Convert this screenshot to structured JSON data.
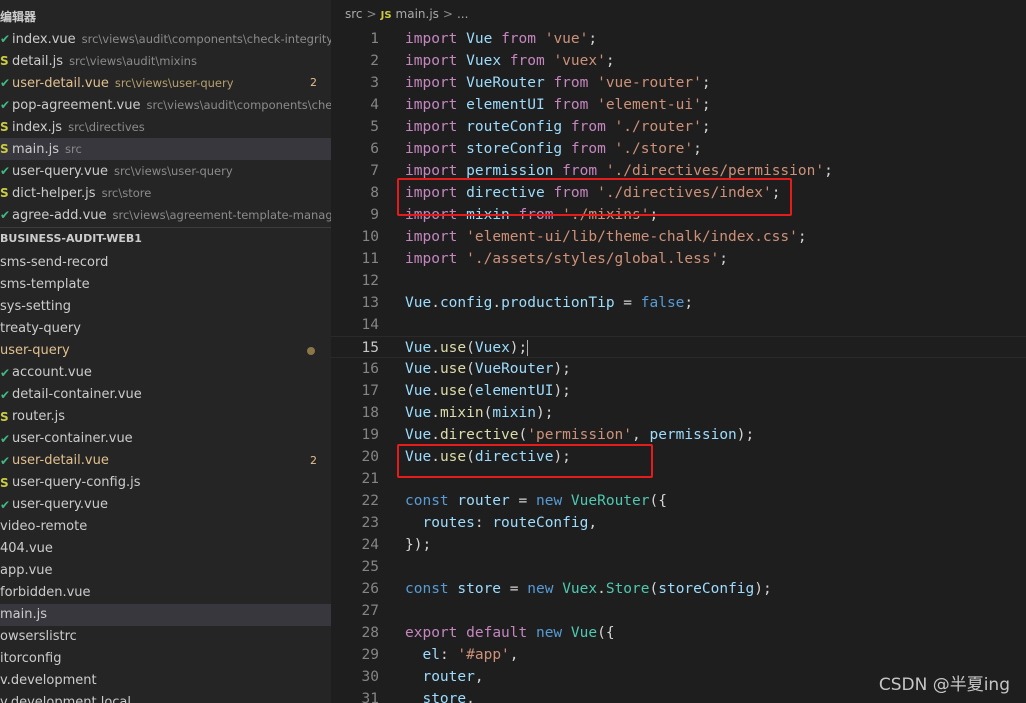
{
  "explorer": {
    "open_editors_title": "编辑器",
    "open_editors": [
      {
        "icon": "check-icon",
        "name": "index.vue",
        "path": "src\\views\\audit\\components\\check-integrity",
        "modified": false,
        "badge": ""
      },
      {
        "icon": "js-icon",
        "name": "detail.js",
        "path": "src\\views\\audit\\mixins",
        "modified": false,
        "badge": ""
      },
      {
        "icon": "check-icon",
        "name": "user-detail.vue",
        "path": "src\\views\\user-query",
        "modified": true,
        "badge": "2"
      },
      {
        "icon": "check-icon",
        "name": "pop-agreement.vue",
        "path": "src\\views\\audit\\components\\check-i...",
        "modified": false,
        "badge": ""
      },
      {
        "icon": "js-icon",
        "name": "index.js",
        "path": "src\\directives",
        "modified": false,
        "badge": ""
      },
      {
        "icon": "js-icon",
        "name": "main.js",
        "path": "src",
        "modified": false,
        "badge": "",
        "selected": true
      },
      {
        "icon": "check-icon",
        "name": "user-query.vue",
        "path": "src\\views\\user-query",
        "modified": false,
        "badge": ""
      },
      {
        "icon": "js-icon",
        "name": "dict-helper.js",
        "path": "src\\store",
        "modified": false,
        "badge": ""
      },
      {
        "icon": "check-icon",
        "name": "agree-add.vue",
        "path": "src\\views\\agreement-template-manage",
        "modified": false,
        "badge": ""
      }
    ],
    "project_title": "BUSINESS-AUDIT-WEB1",
    "tree": [
      {
        "icon": "",
        "name": "sms-send-record",
        "modified": false,
        "badge": "",
        "dot": false
      },
      {
        "icon": "",
        "name": "sms-template",
        "modified": false,
        "badge": "",
        "dot": false
      },
      {
        "icon": "",
        "name": "sys-setting",
        "modified": false,
        "badge": "",
        "dot": false
      },
      {
        "icon": "",
        "name": "treaty-query",
        "modified": false,
        "badge": "",
        "dot": false
      },
      {
        "icon": "",
        "name": "user-query",
        "modified": true,
        "badge": "",
        "dot": true
      },
      {
        "icon": "check-icon",
        "name": "account.vue",
        "modified": false,
        "badge": "",
        "dot": false
      },
      {
        "icon": "check-icon",
        "name": "detail-container.vue",
        "modified": false,
        "badge": "",
        "dot": false
      },
      {
        "icon": "js-icon",
        "name": "router.js",
        "modified": false,
        "badge": "",
        "dot": false
      },
      {
        "icon": "check-icon",
        "name": "user-container.vue",
        "modified": false,
        "badge": "",
        "dot": false
      },
      {
        "icon": "check-icon",
        "name": "user-detail.vue",
        "modified": true,
        "badge": "2",
        "dot": false
      },
      {
        "icon": "js-icon",
        "name": "user-query-config.js",
        "modified": false,
        "badge": "",
        "dot": false
      },
      {
        "icon": "check-icon",
        "name": "user-query.vue",
        "modified": false,
        "badge": "",
        "dot": false
      },
      {
        "icon": "",
        "name": "video-remote",
        "modified": false,
        "badge": "",
        "dot": false
      },
      {
        "icon": "",
        "name": "404.vue",
        "modified": false,
        "badge": "",
        "dot": false
      },
      {
        "icon": "",
        "name": "app.vue",
        "modified": false,
        "badge": "",
        "dot": false
      },
      {
        "icon": "",
        "name": "forbidden.vue",
        "modified": false,
        "badge": "",
        "dot": false
      },
      {
        "icon": "",
        "name": "main.js",
        "modified": false,
        "badge": "",
        "dot": false,
        "selected": true
      },
      {
        "icon": "",
        "name": "owserslistrc",
        "modified": false,
        "badge": "",
        "dot": false
      },
      {
        "icon": "",
        "name": "itorconfig",
        "modified": false,
        "badge": "",
        "dot": false
      },
      {
        "icon": "",
        "name": "v.development",
        "modified": false,
        "badge": "",
        "dot": false
      },
      {
        "icon": "",
        "name": "v.development.local",
        "modified": false,
        "badge": "",
        "dot": false
      }
    ]
  },
  "breadcrumb": {
    "folder": "src",
    "sep": ">",
    "js_label": "JS",
    "file": "main.js",
    "more": "..."
  },
  "editor": {
    "current_line": 15,
    "lines": [
      {
        "n": "1",
        "tokens": [
          [
            "kw2",
            "import"
          ],
          [
            "punc",
            " "
          ],
          [
            "var",
            "Vue"
          ],
          [
            "punc",
            " "
          ],
          [
            "kw2",
            "from"
          ],
          [
            "punc",
            " "
          ],
          [
            "str",
            "'vue'"
          ],
          [
            "punc",
            ";"
          ]
        ]
      },
      {
        "n": "2",
        "tokens": [
          [
            "kw2",
            "import"
          ],
          [
            "punc",
            " "
          ],
          [
            "var",
            "Vuex"
          ],
          [
            "punc",
            " "
          ],
          [
            "kw2",
            "from"
          ],
          [
            "punc",
            " "
          ],
          [
            "str",
            "'vuex'"
          ],
          [
            "punc",
            ";"
          ]
        ]
      },
      {
        "n": "3",
        "tokens": [
          [
            "kw2",
            "import"
          ],
          [
            "punc",
            " "
          ],
          [
            "var",
            "VueRouter"
          ],
          [
            "punc",
            " "
          ],
          [
            "kw2",
            "from"
          ],
          [
            "punc",
            " "
          ],
          [
            "str",
            "'vue-router'"
          ],
          [
            "punc",
            ";"
          ]
        ]
      },
      {
        "n": "4",
        "tokens": [
          [
            "kw2",
            "import"
          ],
          [
            "punc",
            " "
          ],
          [
            "var",
            "elementUI"
          ],
          [
            "punc",
            " "
          ],
          [
            "kw2",
            "from"
          ],
          [
            "punc",
            " "
          ],
          [
            "str",
            "'element-ui'"
          ],
          [
            "punc",
            ";"
          ]
        ]
      },
      {
        "n": "5",
        "tokens": [
          [
            "kw2",
            "import"
          ],
          [
            "punc",
            " "
          ],
          [
            "var",
            "routeConfig"
          ],
          [
            "punc",
            " "
          ],
          [
            "kw2",
            "from"
          ],
          [
            "punc",
            " "
          ],
          [
            "str",
            "'./router'"
          ],
          [
            "punc",
            ";"
          ]
        ]
      },
      {
        "n": "6",
        "tokens": [
          [
            "kw2",
            "import"
          ],
          [
            "punc",
            " "
          ],
          [
            "var",
            "storeConfig"
          ],
          [
            "punc",
            " "
          ],
          [
            "kw2",
            "from"
          ],
          [
            "punc",
            " "
          ],
          [
            "str",
            "'./store'"
          ],
          [
            "punc",
            ";"
          ]
        ]
      },
      {
        "n": "7",
        "tokens": [
          [
            "kw2",
            "import"
          ],
          [
            "punc",
            " "
          ],
          [
            "var",
            "permission"
          ],
          [
            "punc",
            " "
          ],
          [
            "kw2",
            "from"
          ],
          [
            "punc",
            " "
          ],
          [
            "str",
            "'./directives/permission'"
          ],
          [
            "punc",
            ";"
          ]
        ]
      },
      {
        "n": "8",
        "tokens": [
          [
            "kw2",
            "import"
          ],
          [
            "punc",
            " "
          ],
          [
            "var",
            "directive"
          ],
          [
            "punc",
            " "
          ],
          [
            "kw2",
            "from"
          ],
          [
            "punc",
            " "
          ],
          [
            "str",
            "'./directives/index'"
          ],
          [
            "punc",
            ";"
          ]
        ]
      },
      {
        "n": "9",
        "strike": true,
        "tokens": [
          [
            "kw2",
            "import"
          ],
          [
            "punc",
            " "
          ],
          [
            "var",
            "mixin"
          ],
          [
            "punc",
            " "
          ],
          [
            "kw2",
            "from"
          ],
          [
            "punc",
            " "
          ],
          [
            "str",
            "'./mixins'"
          ],
          [
            "punc",
            ";"
          ]
        ]
      },
      {
        "n": "10",
        "tokens": [
          [
            "kw2",
            "import"
          ],
          [
            "punc",
            " "
          ],
          [
            "str",
            "'element-ui/lib/theme-chalk/index.css'"
          ],
          [
            "punc",
            ";"
          ]
        ]
      },
      {
        "n": "11",
        "tokens": [
          [
            "kw2",
            "import"
          ],
          [
            "punc",
            " "
          ],
          [
            "str",
            "'./assets/styles/global.less'"
          ],
          [
            "punc",
            ";"
          ]
        ]
      },
      {
        "n": "12",
        "tokens": []
      },
      {
        "n": "13",
        "tokens": [
          [
            "var",
            "Vue"
          ],
          [
            "punc",
            "."
          ],
          [
            "var",
            "config"
          ],
          [
            "punc",
            "."
          ],
          [
            "var",
            "productionTip"
          ],
          [
            "punc",
            " = "
          ],
          [
            "kw",
            "false"
          ],
          [
            "punc",
            ";"
          ]
        ]
      },
      {
        "n": "14",
        "tokens": []
      },
      {
        "n": "15",
        "cursor": true,
        "tokens": [
          [
            "var",
            "Vue"
          ],
          [
            "punc",
            "."
          ],
          [
            "fn",
            "use"
          ],
          [
            "punc",
            "("
          ],
          [
            "var",
            "Vuex"
          ],
          [
            "punc",
            ");"
          ]
        ]
      },
      {
        "n": "16",
        "tokens": [
          [
            "var",
            "Vue"
          ],
          [
            "punc",
            "."
          ],
          [
            "fn",
            "use"
          ],
          [
            "punc",
            "("
          ],
          [
            "var",
            "VueRouter"
          ],
          [
            "punc",
            ");"
          ]
        ]
      },
      {
        "n": "17",
        "tokens": [
          [
            "var",
            "Vue"
          ],
          [
            "punc",
            "."
          ],
          [
            "fn",
            "use"
          ],
          [
            "punc",
            "("
          ],
          [
            "var",
            "elementUI"
          ],
          [
            "punc",
            ");"
          ]
        ]
      },
      {
        "n": "18",
        "tokens": [
          [
            "var",
            "Vue"
          ],
          [
            "punc",
            "."
          ],
          [
            "fn",
            "mixin"
          ],
          [
            "punc",
            "("
          ],
          [
            "var",
            "mixin"
          ],
          [
            "punc",
            ");"
          ]
        ]
      },
      {
        "n": "19",
        "tokens": [
          [
            "var",
            "Vue"
          ],
          [
            "punc",
            "."
          ],
          [
            "fn",
            "directive"
          ],
          [
            "punc",
            "("
          ],
          [
            "str",
            "'permission'"
          ],
          [
            "punc",
            ", "
          ],
          [
            "var",
            "permission"
          ],
          [
            "punc",
            ");"
          ]
        ]
      },
      {
        "n": "20",
        "tokens": [
          [
            "var",
            "Vue"
          ],
          [
            "punc",
            "."
          ],
          [
            "fn",
            "use"
          ],
          [
            "punc",
            "("
          ],
          [
            "var",
            "directive"
          ],
          [
            "punc",
            ");"
          ]
        ]
      },
      {
        "n": "21",
        "tokens": []
      },
      {
        "n": "22",
        "tokens": [
          [
            "kw",
            "const"
          ],
          [
            "punc",
            " "
          ],
          [
            "var",
            "router"
          ],
          [
            "punc",
            " = "
          ],
          [
            "kw",
            "new"
          ],
          [
            "punc",
            " "
          ],
          [
            "cls",
            "VueRouter"
          ],
          [
            "punc",
            "({"
          ]
        ]
      },
      {
        "n": "23",
        "tokens": [
          [
            "punc",
            "  "
          ],
          [
            "var",
            "routes"
          ],
          [
            "punc",
            ": "
          ],
          [
            "var",
            "routeConfig"
          ],
          [
            "punc",
            ","
          ]
        ]
      },
      {
        "n": "24",
        "tokens": [
          [
            "punc",
            "});"
          ]
        ]
      },
      {
        "n": "25",
        "tokens": []
      },
      {
        "n": "26",
        "tokens": [
          [
            "kw",
            "const"
          ],
          [
            "punc",
            " "
          ],
          [
            "var",
            "store"
          ],
          [
            "punc",
            " = "
          ],
          [
            "kw",
            "new"
          ],
          [
            "punc",
            " "
          ],
          [
            "cls",
            "Vuex"
          ],
          [
            "punc",
            "."
          ],
          [
            "cls",
            "Store"
          ],
          [
            "punc",
            "("
          ],
          [
            "var",
            "storeConfig"
          ],
          [
            "punc",
            ");"
          ]
        ]
      },
      {
        "n": "27",
        "tokens": []
      },
      {
        "n": "28",
        "tokens": [
          [
            "kw2",
            "export"
          ],
          [
            "punc",
            " "
          ],
          [
            "kw2",
            "default"
          ],
          [
            "punc",
            " "
          ],
          [
            "kw",
            "new"
          ],
          [
            "punc",
            " "
          ],
          [
            "cls",
            "Vue"
          ],
          [
            "punc",
            "({"
          ]
        ]
      },
      {
        "n": "29",
        "tokens": [
          [
            "punc",
            "  "
          ],
          [
            "var",
            "el"
          ],
          [
            "punc",
            ": "
          ],
          [
            "str",
            "'#app'"
          ],
          [
            "punc",
            ","
          ]
        ]
      },
      {
        "n": "30",
        "tokens": [
          [
            "punc",
            "  "
          ],
          [
            "var",
            "router"
          ],
          [
            "punc",
            ","
          ]
        ]
      },
      {
        "n": "31",
        "tokens": [
          [
            "punc",
            "  "
          ],
          [
            "var",
            "store"
          ],
          [
            "punc",
            ","
          ]
        ]
      }
    ]
  },
  "watermark": "CSDN @半夏ing",
  "colors": {
    "annotation": "#e51c1c",
    "keyword": "#c586c0",
    "string": "#ce9178",
    "variable": "#9cdcfe"
  }
}
